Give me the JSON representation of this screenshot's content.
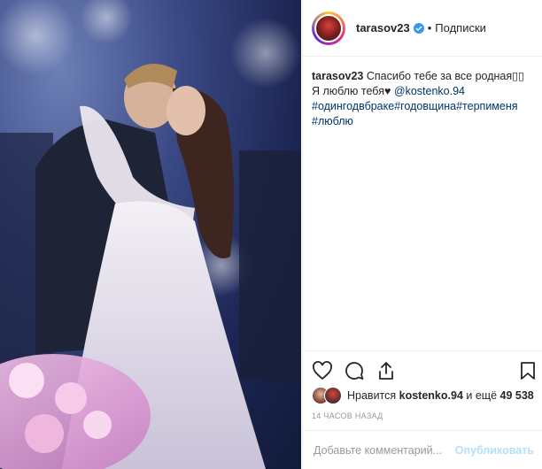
{
  "post": {
    "username": "tarasov23",
    "follow_separator": "•",
    "follow_label": "Подписки",
    "caption": {
      "user": "tarasov23",
      "line1": "Спасибо тебе за все родная▯▯",
      "line2_text": "Я люблю тебя",
      "heart": "♥",
      "mention": "@kostenko.94",
      "hashtags1": "#одингодвбраке#годовщина#терпименя",
      "hashtags2": "#люблю"
    },
    "likes": {
      "prefix": "Нравится ",
      "user": "kostenko.94",
      "middle": " и ещё ",
      "count": "49 538"
    },
    "timestamp": "14 ЧАСОВ НАЗАД",
    "comment_placeholder": "Добавьте комментарий...",
    "publish_label": "Опубликовать"
  },
  "icons": {
    "like": "heart-outline-icon",
    "comment": "speech-bubble-icon",
    "share": "share-icon",
    "save": "bookmark-icon",
    "verified": "verified-badge-icon"
  },
  "colors": {
    "link": "#003569",
    "verified": "#3897f0",
    "muted": "#999999"
  }
}
